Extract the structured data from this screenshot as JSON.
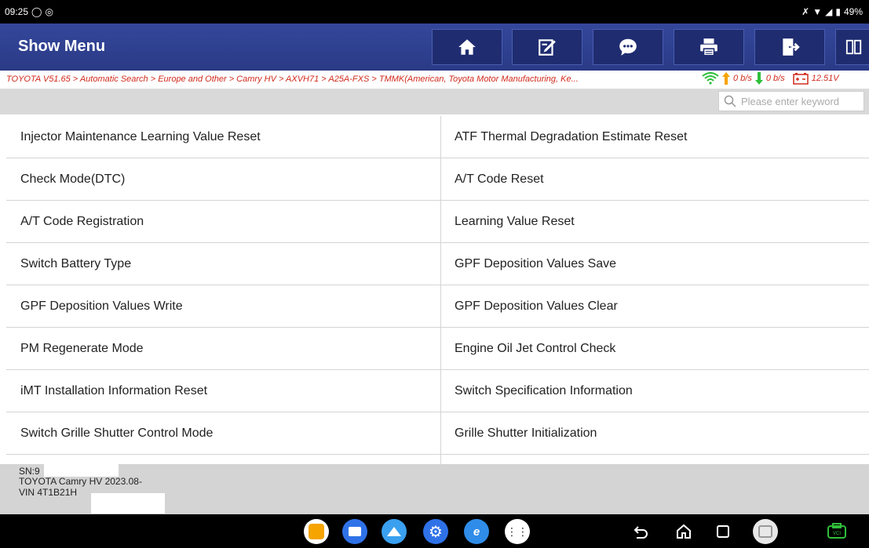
{
  "status_bar": {
    "time": "09:25",
    "battery": "49%"
  },
  "header": {
    "title": "Show Menu",
    "buttons": [
      "home-icon",
      "edit-report-icon",
      "message-icon",
      "print-icon",
      "exit-icon",
      "split-view-icon"
    ]
  },
  "breadcrumb": "TOYOTA V51.65 > Automatic Search > Europe and Other > Camry HV > AXVH71 > A25A-FXS > TMMK(American, Toyota Motor Manufacturing, Ke...",
  "network": {
    "up": "0 b/s",
    "down": "0 b/s",
    "voltage": "12.51V"
  },
  "search": {
    "placeholder": "Please enter keyword"
  },
  "menu_items": [
    "Injector Maintenance Learning Value Reset",
    "ATF Thermal Degradation Estimate Reset",
    "Check Mode(DTC)",
    "A/T Code Reset",
    "A/T Code Registration",
    "Learning Value Reset",
    "Switch Battery Type",
    "GPF Deposition Values Save",
    "GPF Deposition Values Write",
    "GPF Deposition Values Clear",
    "PM Regenerate Mode",
    "Engine Oil Jet Control Check",
    "iMT Installation Information Reset",
    "Switch Specification Information",
    "Switch Grille Shutter Control Mode",
    "Grille Shutter Initialization",
    "",
    ""
  ],
  "footer": {
    "sn": "SN:9",
    "vehicle": "TOYOTA Camry HV 2023.08-",
    "vin": "VIN 4T1B21H"
  },
  "colors": {
    "header_bg": "#2e3f8f",
    "breadcrumb": "#d12a1c",
    "wifi": "#2fbf3a",
    "up_arrow": "#f5a400",
    "down_arrow": "#2fbf3a"
  }
}
